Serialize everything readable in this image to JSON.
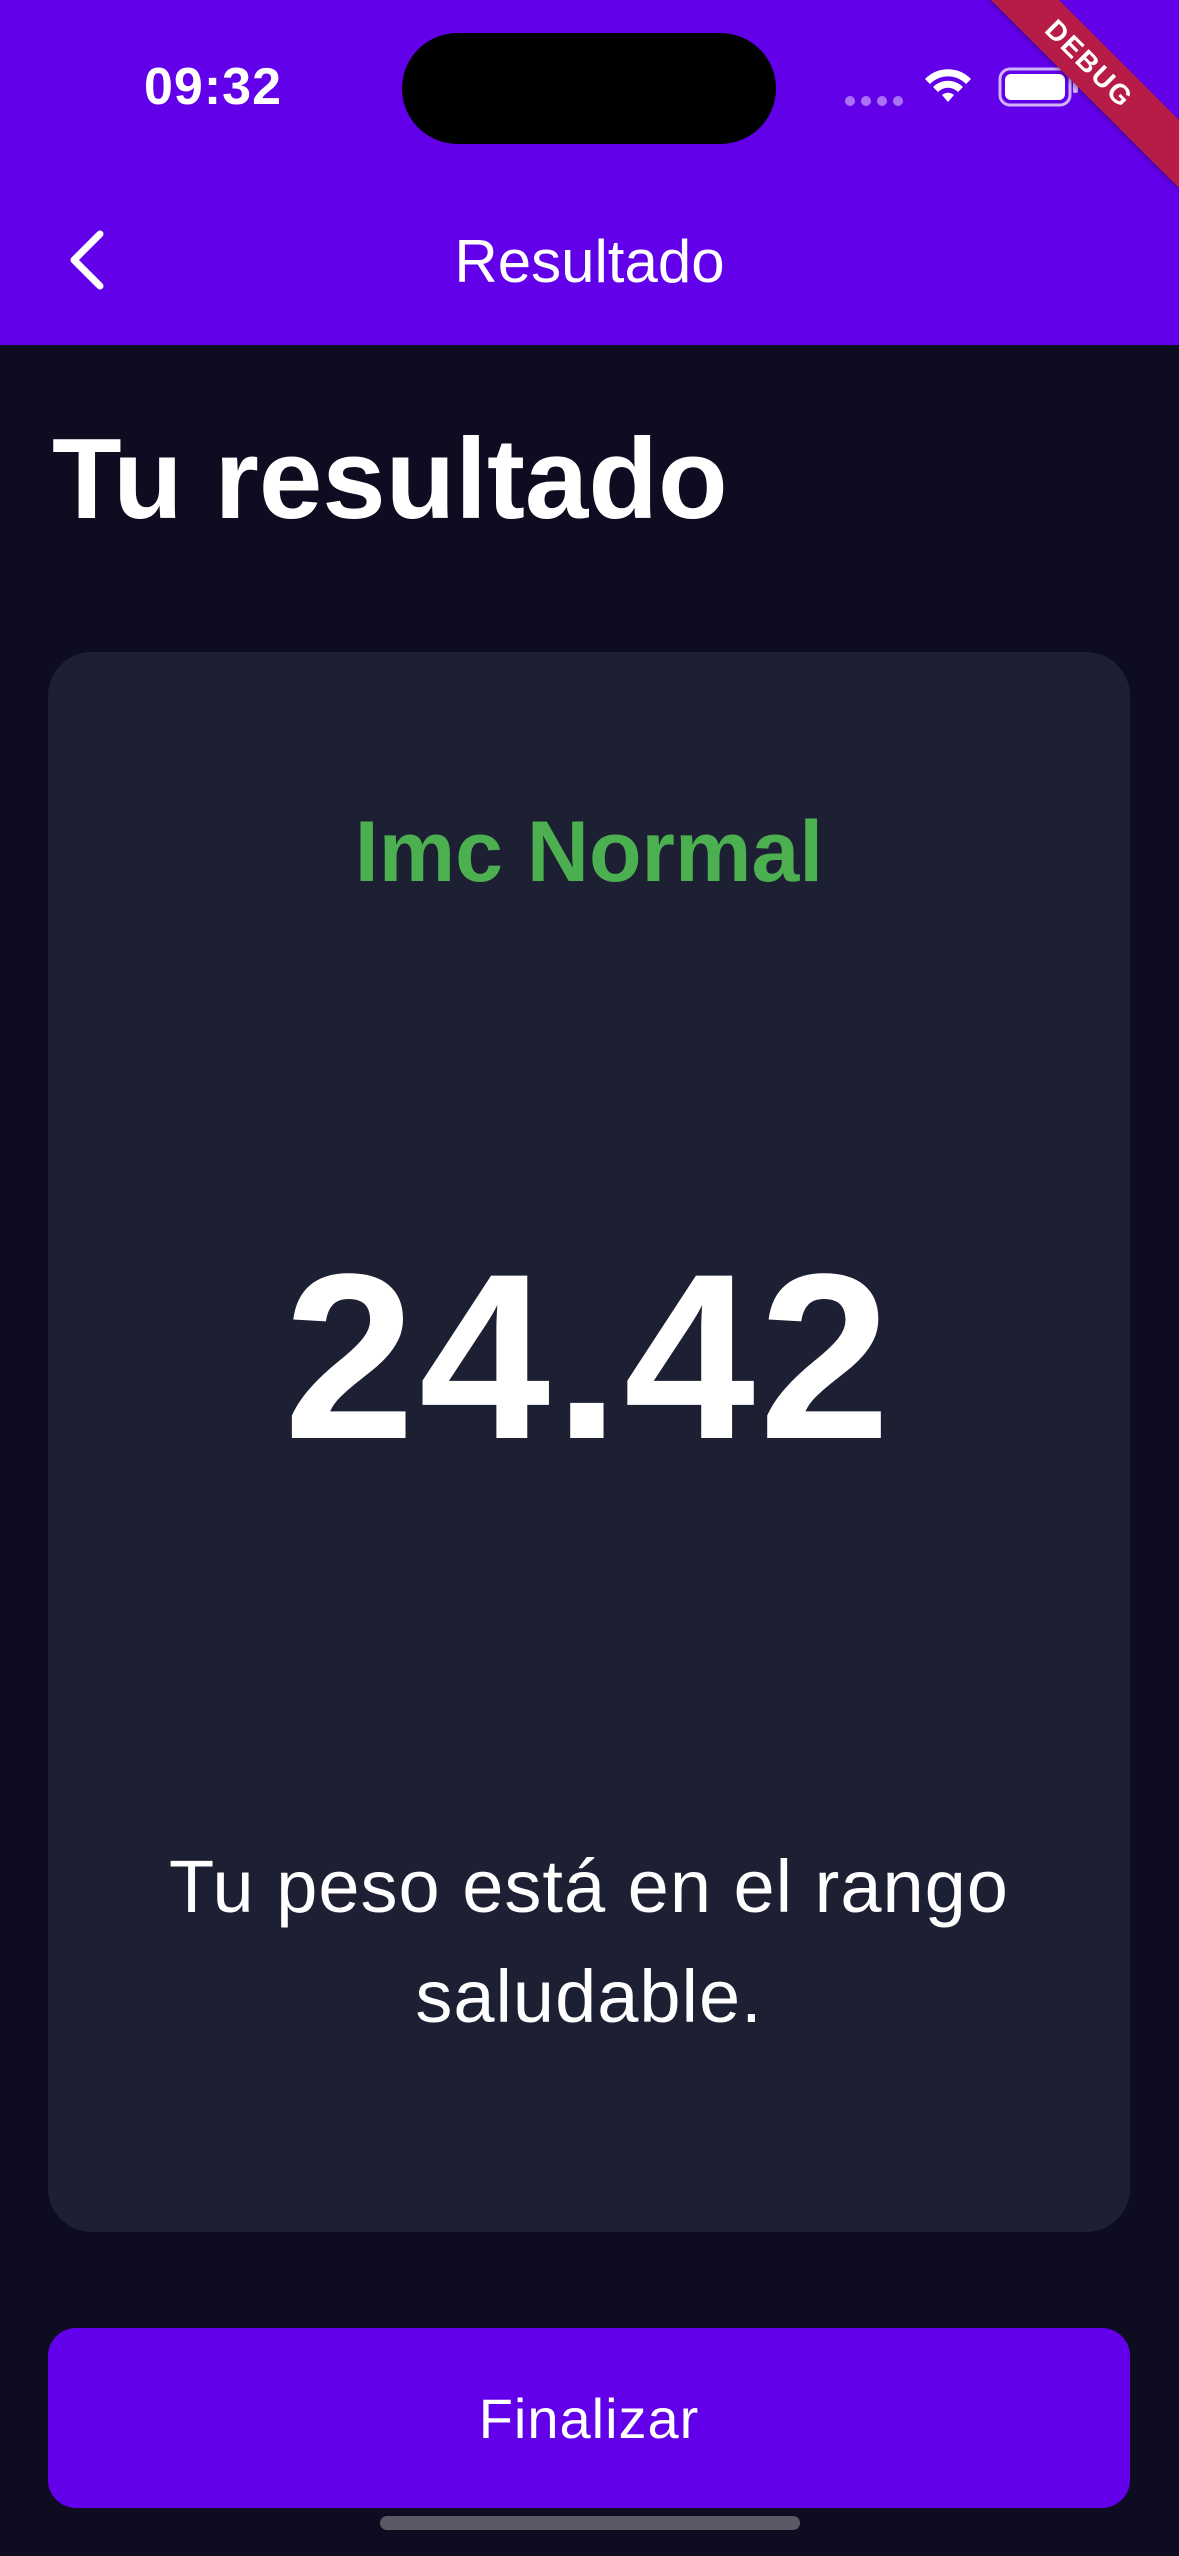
{
  "status_bar": {
    "time": "09:32",
    "debug_label": "DEBUG"
  },
  "appbar": {
    "title": "Resultado",
    "back_icon": "chevron-left-icon"
  },
  "page": {
    "title": "Tu resultado"
  },
  "result_card": {
    "category": "Imc Normal",
    "category_color": "#4caf50",
    "value": "24.42",
    "description": "Tu peso está en el rango saludable."
  },
  "actions": {
    "finish_label": "Finalizar"
  },
  "colors": {
    "primary": "#6200ea",
    "background": "#0e0c20",
    "card": "#1d1f33"
  }
}
